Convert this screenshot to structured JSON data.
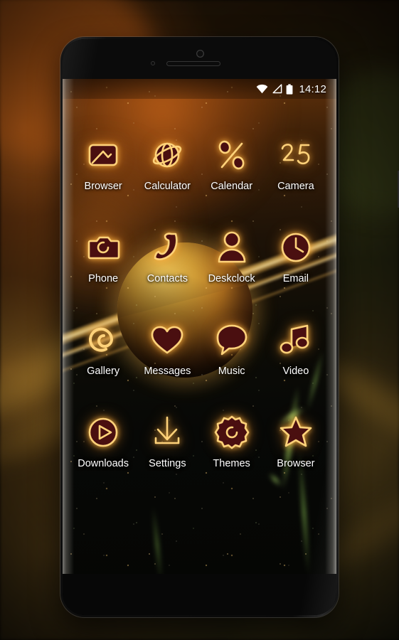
{
  "device": {
    "type": "android-smartphone",
    "front_camera": "front-camera",
    "earpiece": "earpiece-speaker",
    "proximity_sensor": "proximity-sensor",
    "volume_up": "volume-up-button",
    "volume_down": "volume-down-button",
    "power": "power-button"
  },
  "status_bar": {
    "wifi_icon": "wifi-icon",
    "signal_icon": "signal-triangle-icon",
    "battery_icon": "battery-icon",
    "time": "14:12"
  },
  "wallpaper": {
    "theme_name": "golden-planet-space",
    "accent": "#ffd27a",
    "icon_fill": "#4a0f10",
    "label_color": "#ffffff"
  },
  "home_screen": {
    "rows": 4,
    "columns": 4,
    "apps": [
      {
        "label": "Browser",
        "icon": "image-frame-icon"
      },
      {
        "label": "Calculator",
        "icon": "globe-orbit-icon"
      },
      {
        "label": "Calendar",
        "icon": "percent-icon"
      },
      {
        "label": "Camera",
        "icon": "number-25-icon"
      },
      {
        "label": "Phone",
        "icon": "camera-icon"
      },
      {
        "label": "Contacts",
        "icon": "phone-handset-icon"
      },
      {
        "label": "Deskclock",
        "icon": "person-icon"
      },
      {
        "label": "Email",
        "icon": "clock-icon"
      },
      {
        "label": "Gallery",
        "icon": "spiral-shell-icon"
      },
      {
        "label": "Messages",
        "icon": "heart-icon"
      },
      {
        "label": "Music",
        "icon": "speech-bubble-icon"
      },
      {
        "label": "Video",
        "icon": "music-note-icon"
      },
      {
        "label": "Downloads",
        "icon": "play-circle-icon"
      },
      {
        "label": "Settings",
        "icon": "download-arrow-icon"
      },
      {
        "label": "Themes",
        "icon": "gear-icon"
      },
      {
        "label": "Browser",
        "icon": "star-icon"
      }
    ]
  }
}
